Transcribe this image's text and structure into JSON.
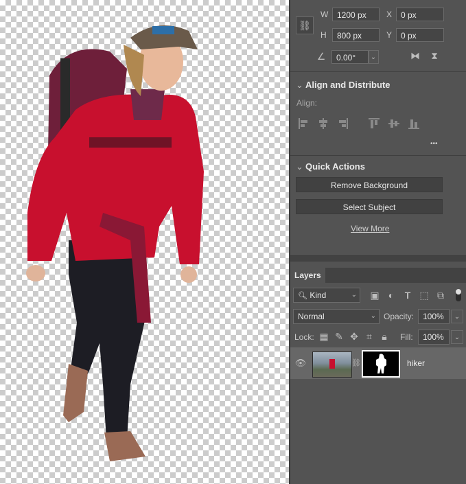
{
  "properties": {
    "w_label": "W",
    "w_value": "1200 px",
    "h_label": "H",
    "h_value": "800 px",
    "x_label": "X",
    "x_value": "0 px",
    "y_label": "Y",
    "y_value": "0 px",
    "angle_value": "0.00°"
  },
  "align": {
    "title": "Align and Distribute",
    "align_label": "Align:",
    "more": "•••"
  },
  "quick_actions": {
    "title": "Quick Actions",
    "remove_bg": "Remove Background",
    "select_subject": "Select Subject",
    "view_more": "View More"
  },
  "layers": {
    "tab": "Layers",
    "filter_kind": "Kind",
    "blend_mode": "Normal",
    "opacity_label": "Opacity:",
    "opacity_value": "100%",
    "lock_label": "Lock:",
    "fill_label": "Fill:",
    "fill_value": "100%",
    "layer_name": "hiker"
  },
  "colors": {
    "panel_bg": "#535353",
    "jacket": "#c8102e",
    "selected_layer": "#676767"
  }
}
